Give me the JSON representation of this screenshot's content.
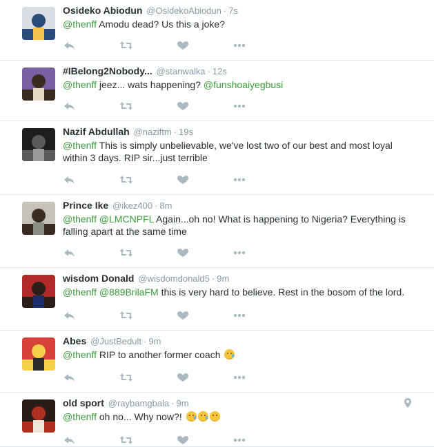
{
  "tweets": [
    {
      "fullname": "Osideko Abiodun",
      "username": "@OsidekoAbiodun",
      "time": "7s",
      "parts": [
        {
          "type": "mention",
          "text": "@thenff"
        },
        {
          "type": "text",
          "text": " Amodu  dead? Us this a joke?"
        }
      ],
      "avatar_colors": [
        "#d9dde3",
        "#2a4a7a",
        "#f2c34a"
      ]
    },
    {
      "fullname": "#IBelong2Nobody...",
      "username": "@stanwalka",
      "time": "12s",
      "parts": [
        {
          "type": "mention",
          "text": "@thenff"
        },
        {
          "type": "text",
          "text": " jeez... wats happening? "
        },
        {
          "type": "mention",
          "text": "@funshoaiyegbusi"
        }
      ],
      "avatar_colors": [
        "#7c5fa0",
        "#3b2a1f",
        "#e7d9c5"
      ]
    },
    {
      "fullname": "Nazif Abdullah",
      "username": "@naziftm",
      "time": "19s",
      "parts": [
        {
          "type": "mention",
          "text": "@thenff"
        },
        {
          "type": "text",
          "text": " This is simply unbelievable, we've lost two of our best and most loyal within 3 days. RIP sir...just terrible"
        }
      ],
      "avatar_colors": [
        "#1e1e1e",
        "#5a5a5a",
        "#9a9a9a"
      ]
    },
    {
      "fullname": "Prince Ike",
      "username": "@ikez400",
      "time": "8m",
      "parts": [
        {
          "type": "mention",
          "text": "@thenff"
        },
        {
          "type": "text",
          "text": " "
        },
        {
          "type": "mention",
          "text": "@LMCNPFL"
        },
        {
          "type": "text",
          "text": " Again...oh no! What is happening to Nigeria? Everything is falling apart at the same time"
        }
      ],
      "avatar_colors": [
        "#c7c2b7",
        "#3a2b22",
        "#8a8d84"
      ]
    },
    {
      "fullname": "wisdom Donald",
      "username": "@wisdomdonald5",
      "time": "9m",
      "parts": [
        {
          "type": "mention",
          "text": "@thenff"
        },
        {
          "type": "text",
          "text": " "
        },
        {
          "type": "mention",
          "text": "@889BrilaFM"
        },
        {
          "type": "text",
          "text": " this is very hard to believe. Rest in the bosom of the lord."
        }
      ],
      "avatar_colors": [
        "#b02a2a",
        "#2b1d18",
        "#1c2f6b"
      ]
    },
    {
      "fullname": "Abes",
      "username": "@JustBedult",
      "time": "9m",
      "parts": [
        {
          "type": "mention",
          "text": "@thenff"
        },
        {
          "type": "text",
          "text": " RIP to another former coach "
        },
        {
          "type": "emoji",
          "text": "crying-face-emoji"
        }
      ],
      "avatar_colors": [
        "#d8403a",
        "#f3d24a",
        "#2a2a2a"
      ]
    },
    {
      "fullname": "old sport",
      "username": "@raybamgbala",
      "time": "9m",
      "parts": [
        {
          "type": "mention",
          "text": "@thenff"
        },
        {
          "type": "text",
          "text": " oh no... Why now?! "
        },
        {
          "type": "emoji",
          "text": "crying-face-emoji"
        },
        {
          "type": "emoji",
          "text": "crying-face-emoji"
        },
        {
          "type": "emoji",
          "text": "sad-face-emoji"
        }
      ],
      "avatar_colors": [
        "#2a1a14",
        "#b03020",
        "#f0e6d8"
      ],
      "has_geo": true
    }
  ],
  "colors": {
    "mention": "#3b94d9",
    "mention_alt": "#3b9c3b",
    "meta": "#8899a6",
    "divider": "#e1e8ed",
    "icon": "#aab8c2"
  },
  "icons": [
    "reply-icon",
    "retweet-icon",
    "like-icon",
    "more-icon",
    "location-pin-icon"
  ]
}
